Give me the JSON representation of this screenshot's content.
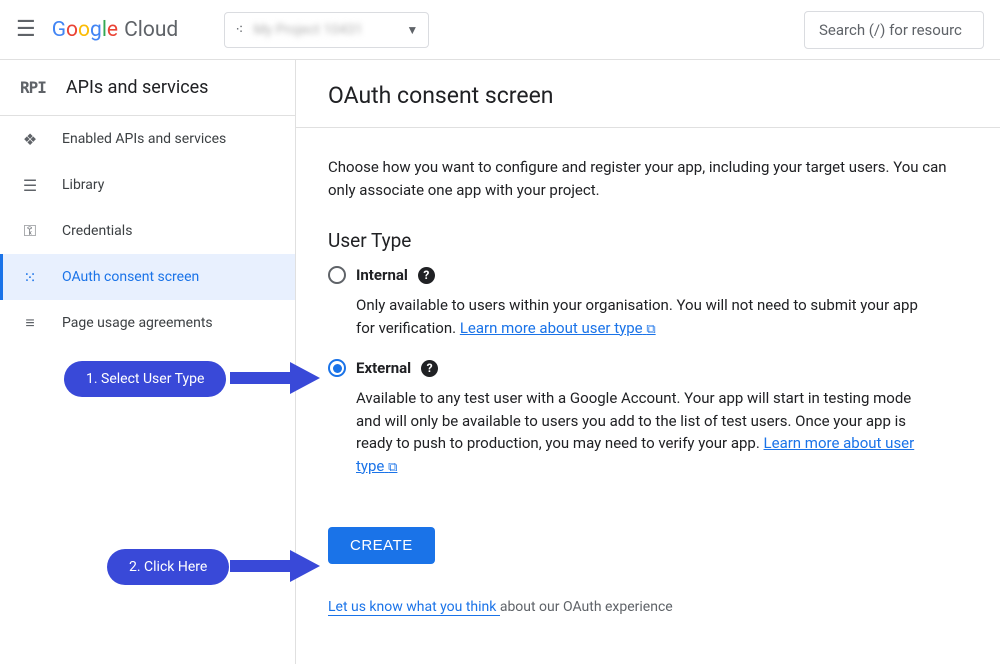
{
  "header": {
    "logo_letters": [
      "G",
      "o",
      "o",
      "g",
      "l",
      "e"
    ],
    "cloud": "Cloud",
    "project_name": "My Project 10431",
    "search_placeholder": "Search (/) for resourc"
  },
  "sidebar": {
    "badge": "RPI",
    "title": "APIs and services",
    "items": [
      {
        "label": "Enabled APIs and services",
        "icon": "❖"
      },
      {
        "label": "Library",
        "icon": "☰"
      },
      {
        "label": "Credentials",
        "icon": "⚿"
      },
      {
        "label": "OAuth consent screen",
        "icon": "⁙"
      },
      {
        "label": "Page usage agreements",
        "icon": "≡"
      }
    ]
  },
  "main": {
    "title": "OAuth consent screen",
    "description": "Choose how you want to configure and register your app, including your target users. You can only associate one app with your project.",
    "user_type_heading": "User Type",
    "options": {
      "internal": {
        "label": "Internal",
        "desc": "Only available to users within your organisation. You will not need to submit your app for verification. ",
        "link": "Learn more about user type"
      },
      "external": {
        "label": "External",
        "desc": "Available to any test user with a Google Account. Your app will start in testing mode and will only be available to users you add to the list of test users. Once your app is ready to push to production, you may need to verify your app. ",
        "link": "Learn more about user type"
      }
    },
    "create_button": "CREATE",
    "feedback_link": "Let us know what you think ",
    "feedback_rest": "about our OAuth experience"
  },
  "annotations": {
    "step1": "1. Select User Type",
    "step2": "2. Click Here"
  }
}
